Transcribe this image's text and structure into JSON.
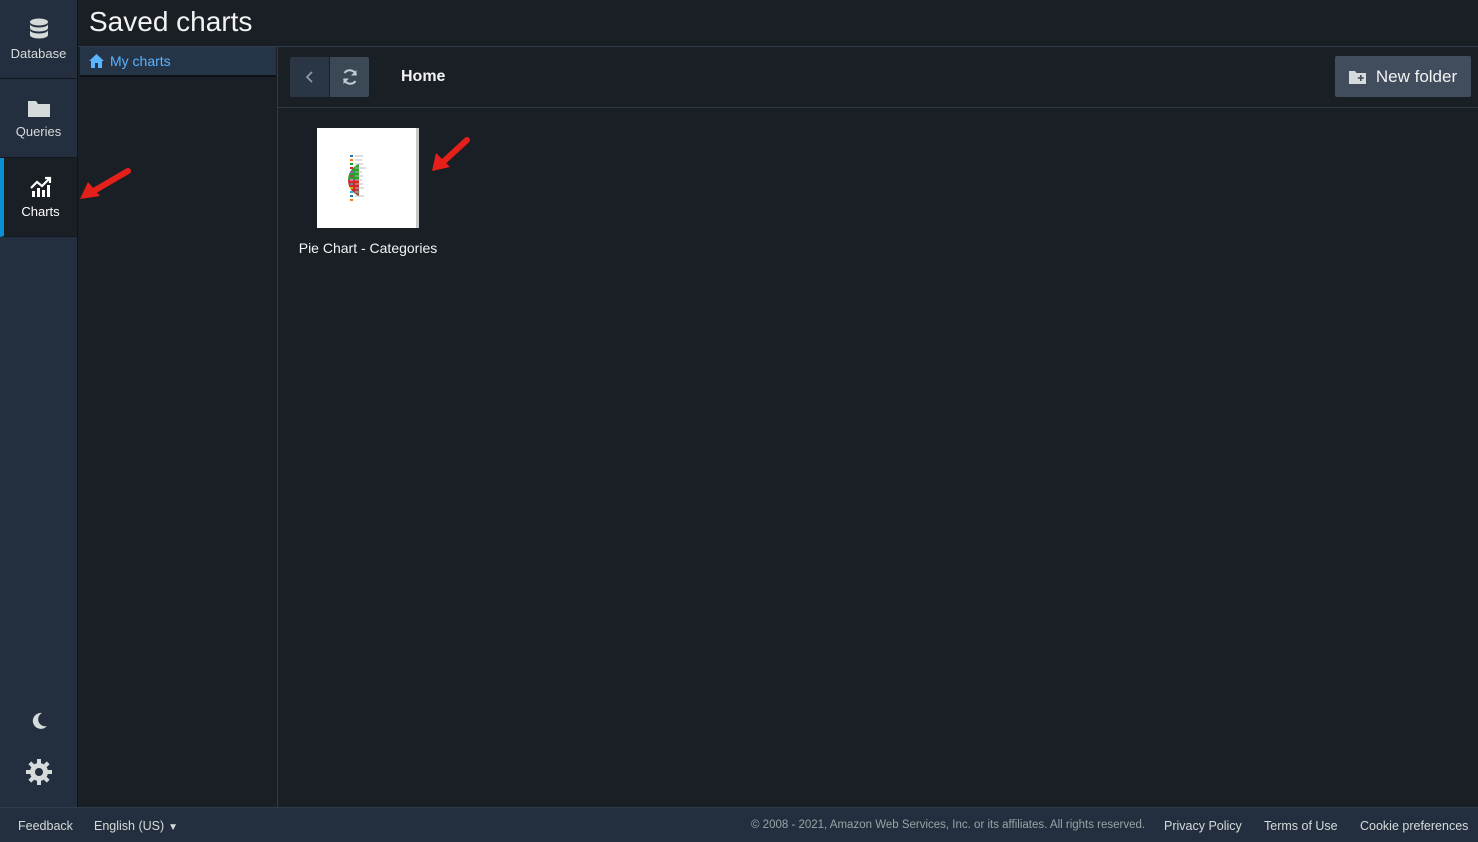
{
  "page": {
    "title": "Saved charts"
  },
  "rail": {
    "database_label": "Database",
    "queries_label": "Queries",
    "charts_label": "Charts"
  },
  "tree": {
    "my_charts_label": "My charts"
  },
  "toolbar": {
    "breadcrumb": "Home",
    "new_folder_label": "New folder"
  },
  "items": [
    {
      "name": "Pie Chart - Categories",
      "icon": "pie-chart-thumbnail"
    }
  ],
  "footer": {
    "feedback": "Feedback",
    "language": "English (US)",
    "copyright": "© 2008 - 2021, Amazon Web Services, Inc. or its affiliates. All rights reserved.",
    "privacy": "Privacy Policy",
    "terms": "Terms of Use",
    "cookies": "Cookie preferences"
  },
  "colors": {
    "accent": "#0a8fd4",
    "link": "#5ab4ff",
    "annotation_arrow": "#e5201b"
  }
}
